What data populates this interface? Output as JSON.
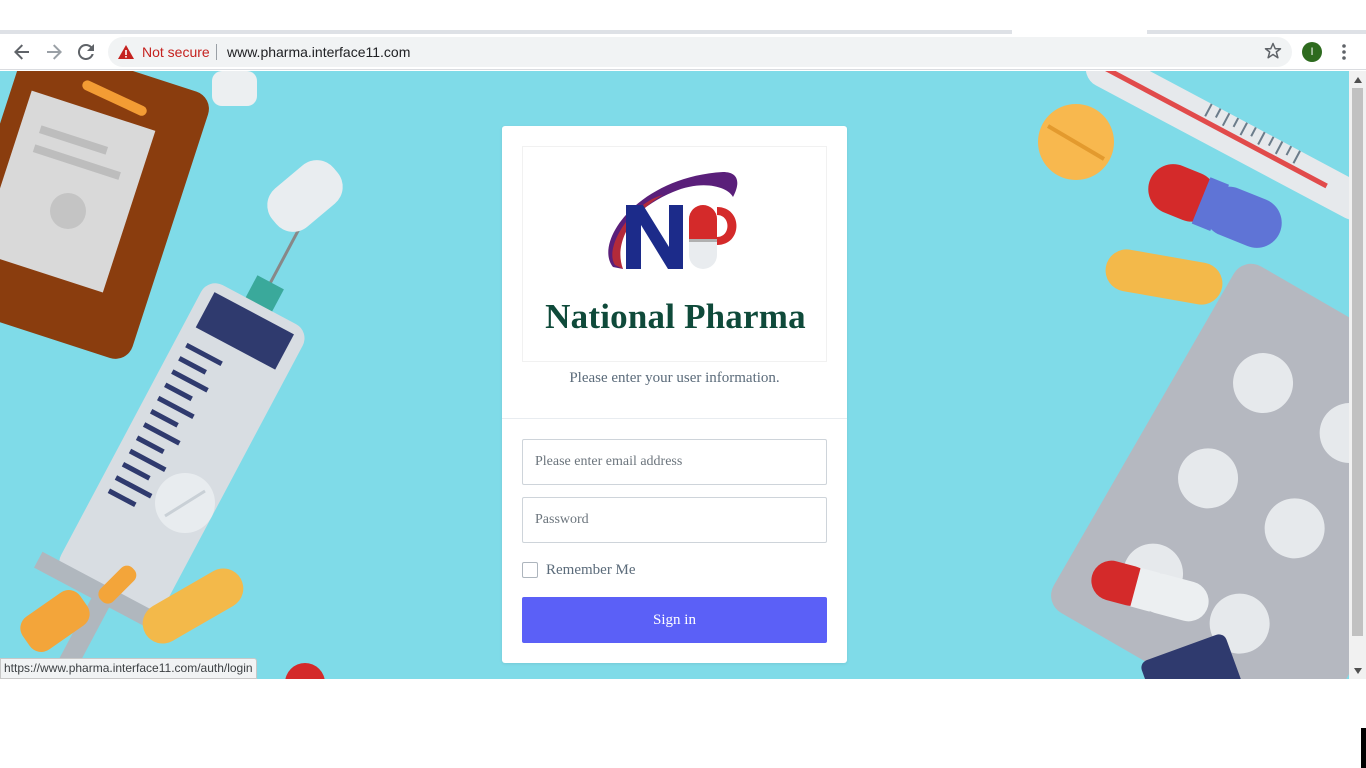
{
  "browser": {
    "security_label": "Not secure",
    "url": "www.pharma.interface11.com",
    "profile_initial": "I",
    "status_url": "https://www.pharma.interface11.com/auth/login",
    "icons": [
      "back-icon",
      "forward-icon",
      "reload-icon",
      "warning-icon",
      "star-icon",
      "menu-icon"
    ]
  },
  "login": {
    "brand": "National Pharma",
    "intro": "Please enter your user information.",
    "email_placeholder": "Please enter email address",
    "password_placeholder": "Password",
    "remember_label": "Remember Me",
    "signin_label": "Sign in"
  },
  "colors": {
    "background": "#7fdbe8",
    "primary_button": "#5b60f7",
    "brand_text": "#0f4a3a",
    "logo_navy": "#1c2b8a",
    "logo_red": "#d42a2a",
    "warning_red": "#c5221f"
  }
}
